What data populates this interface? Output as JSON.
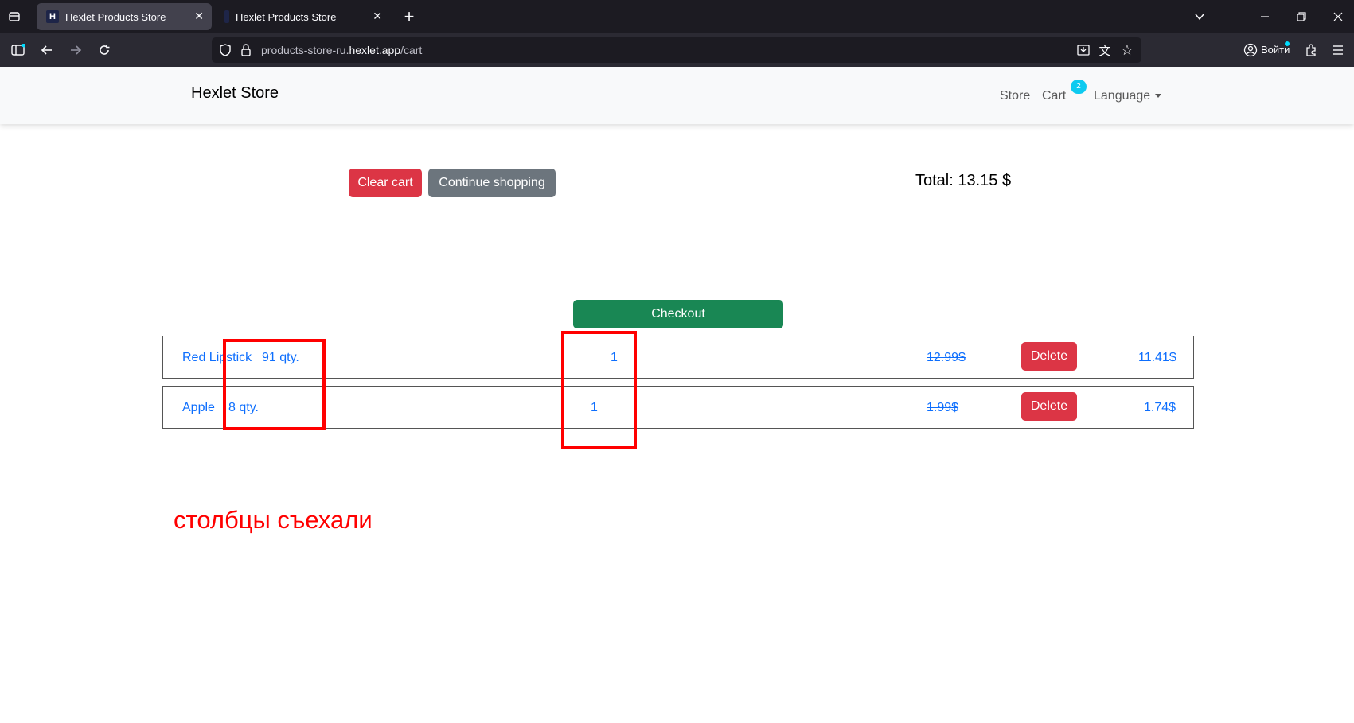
{
  "browser": {
    "tabs": [
      {
        "title": "Hexlet Products Store",
        "favicon": "H",
        "active": true
      },
      {
        "title": "Hexlet Products Store",
        "favicon": "",
        "active": false
      }
    ],
    "url_prefix": "products-store-ru.",
    "url_domain": "hexlet.app",
    "url_path": "/cart",
    "sign_in_label": "Войти",
    "icons": [
      "tab-list-icon",
      "new-tab-icon",
      "dropdown-icon",
      "minimize-icon",
      "restore-icon",
      "close-icon",
      "sidebar-icon",
      "back-icon",
      "forward-icon",
      "reload-icon",
      "shield-icon",
      "lock-icon",
      "download-page-icon",
      "translate-icon",
      "star-icon",
      "account-icon",
      "extensions-icon",
      "menu-icon"
    ]
  },
  "navbar": {
    "brand": "Hexlet Store",
    "store": "Store",
    "cart": "Cart",
    "cart_badge": "2",
    "language": "Language"
  },
  "cart": {
    "clear_label": "Clear cart",
    "continue_label": "Continue shopping",
    "total": "Total: 13.15 $",
    "checkout_label": "Checkout",
    "items": [
      {
        "name": "Red Lipstick",
        "stock": "91 qty.",
        "quantity": "1",
        "old_price": "12.99$",
        "delete_label": "Delete",
        "price": "11.41$"
      },
      {
        "name": "Apple",
        "stock": "8 qty.",
        "quantity": "1",
        "old_price": "1.99$",
        "delete_label": "Delete",
        "price": "1.74$"
      }
    ]
  },
  "annotation": {
    "note": "столбцы съехали",
    "color": "#ff0000"
  },
  "colors": {
    "danger": "#dc3545",
    "secondary": "#6c757d",
    "success": "#198754",
    "link": "#0d6efd",
    "badge": "#0dcaf0"
  }
}
